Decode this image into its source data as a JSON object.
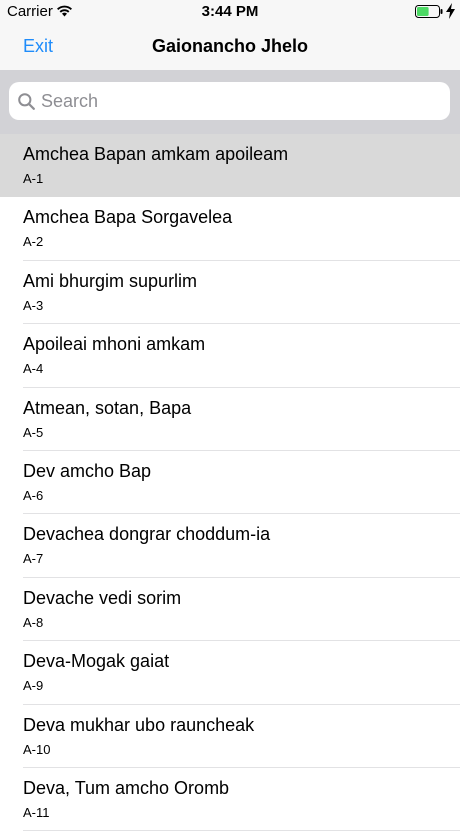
{
  "status_bar": {
    "carrier": "Carrier",
    "time": "3:44 PM",
    "battery_fill_fraction": 0.55,
    "battery_color": "#4cd964"
  },
  "nav": {
    "exit_label": "Exit",
    "title": "Gaionancho Jhelo",
    "accent_color": "#1f8cfa"
  },
  "search": {
    "placeholder": "Search",
    "value": ""
  },
  "list": {
    "items": [
      {
        "title": "Amchea Bapan amkam apoileam",
        "subtitle": "A-1",
        "selected": true
      },
      {
        "title": "Amchea Bapa Sorgavelea",
        "subtitle": "A-2"
      },
      {
        "title": "Ami bhurgim supurlim",
        "subtitle": "A-3"
      },
      {
        "title": "Apoileai mhoni amkam",
        "subtitle": "A-4"
      },
      {
        "title": "Atmean, sotan, Bapa",
        "subtitle": "A-5"
      },
      {
        "title": "Dev amcho Bap",
        "subtitle": "A-6"
      },
      {
        "title": "Devachea dongrar choddum-ia",
        "subtitle": "A-7"
      },
      {
        "title": "Devache vedi sorim",
        "subtitle": "A-8"
      },
      {
        "title": "Deva-Mogak gaiat",
        "subtitle": "A-9"
      },
      {
        "title": "Deva mukhar ubo rauncheak",
        "subtitle": "A-10"
      },
      {
        "title": "Deva, Tum amcho Oromb",
        "subtitle": "A-11"
      }
    ]
  }
}
